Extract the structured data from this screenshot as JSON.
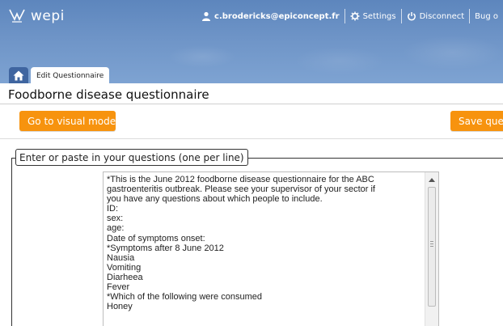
{
  "app": {
    "logo_text": "wepi",
    "logo_icon": "wepi-logo-icon"
  },
  "topnav": {
    "user_email": "c.brodericks@epiconcept.fr",
    "settings_label": "Settings",
    "disconnect_label": "Disconnect",
    "bug_label": "Bug o"
  },
  "tabs": {
    "edit_label": "Edit Questionnaire"
  },
  "page": {
    "title": "Foodborne disease questionnaire"
  },
  "buttons": {
    "visual_mode": "Go to visual mode",
    "save": "Save ques"
  },
  "editor": {
    "legend": "Enter or paste in your questions (one per line)",
    "lines": [
      "*This is the June 2012 foodborne disease questionnaire for the ABC",
      "gastroenteritis outbreak. Please see your supervisor of your sector if",
      "you have any questions about which people to include.",
      "ID:",
      "sex:",
      "age:",
      "Date of symptoms onset:",
      "*Symptoms after 8 June 2012",
      "Nausia",
      "Vomiting",
      "Diarheea",
      "Fever",
      "*Which of the following were consumed",
      "Honey"
    ]
  },
  "colors": {
    "header": "#6e94c7",
    "accent": "#f7930e",
    "home_tab": "#3f65a0"
  }
}
